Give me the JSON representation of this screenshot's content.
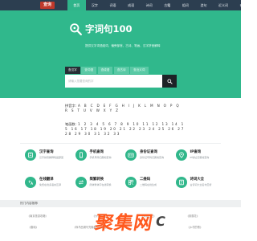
{
  "nav": {
    "logo": "查询",
    "items": [
      "首页",
      "汉字",
      "词语",
      "成语",
      "诗词",
      "古籍",
      "组词",
      "造句",
      "近义词",
      "在线翻译"
    ],
    "active_index": 0
  },
  "hero": {
    "brand_name": "字词句100",
    "slogan": "提供汉字词语组词、偏旁部首、古诗、笔画、汉字拼音解释",
    "tabs": [
      "查汉字",
      "查词语",
      "查成语",
      "查古诗",
      "查近义词"
    ],
    "active_tab": 0,
    "search_placeholder": "请输入您要查询的字"
  },
  "index": {
    "pinyin_label": "拼音字:",
    "pinyin_chars": "A B C D E F G H I J K L M N O P Q R S T U V W X Y Z",
    "stroke_label": "笔画数:",
    "stroke_chars": "1 2 3 4 5 6 7 8 9 10 11 12 13 14 15 16 17 18 19 20 21 22 23 24 25 26 27 28 29 30 31 32 33"
  },
  "tools": [
    {
      "icon": "book-icon",
      "title": "汉字查询",
      "desc": "汉字拼音解释笔画部首"
    },
    {
      "icon": "phone-icon",
      "title": "手机查询",
      "desc": "手机号码归属地查询"
    },
    {
      "icon": "id-card-icon",
      "title": "身份证查询",
      "desc": "身份证号码归属地查询"
    },
    {
      "icon": "location-icon",
      "title": "IP查询",
      "desc": "IP地址归属地查询"
    },
    {
      "icon": "translate-icon",
      "title": "在线翻译",
      "desc": "免费在线多语言互译"
    },
    {
      "icon": "convert-icon",
      "title": "简繁转换",
      "desc": "简体繁体字在线转换"
    },
    {
      "icon": "qrcode-icon",
      "title": "二维码",
      "desc": "二维码在线生成"
    },
    {
      "icon": "poem-icon",
      "title": "诗词大全",
      "desc": "古诗词大全名句赏析"
    }
  ],
  "hot": {
    "title": "热门内容推荐",
    "items": [
      "《南京旅游攻略》",
      "《大学英语》",
      "《中国历史》",
      "《紫藤花》",
      "《春晓》",
      "《咏鸟西湖写完晚春诗词欣赏》",
      "《乡村的歌》"
    ]
  },
  "watermark": {
    "text": "聚集网",
    "suffix": "C"
  },
  "colors": {
    "nav_bg": "#2c3e50",
    "accent": "#30b88c",
    "search_btn": "#1d2327",
    "logo": "#c0392b"
  }
}
